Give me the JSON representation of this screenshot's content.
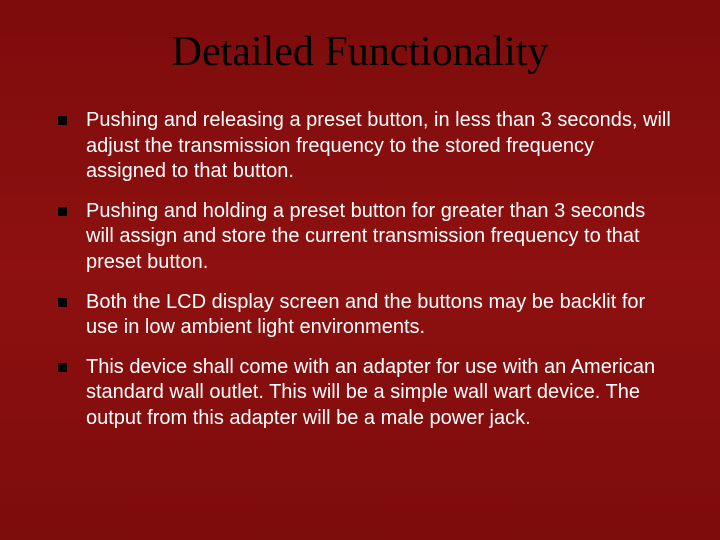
{
  "slide": {
    "title": "Detailed Functionality",
    "bullets": [
      "Pushing and releasing a preset button, in less than 3 seconds, will adjust the transmission frequency to the stored frequency assigned to that button.",
      "Pushing and holding a preset button for greater than 3 seconds will assign and store the current transmission frequency to that preset button.",
      "Both the LCD display screen and the buttons may be backlit for use in low ambient light environments.",
      "This device shall come with an adapter for use with an American standard wall outlet.  This will be a simple wall wart device.  The output from this adapter will be a male power jack."
    ]
  }
}
